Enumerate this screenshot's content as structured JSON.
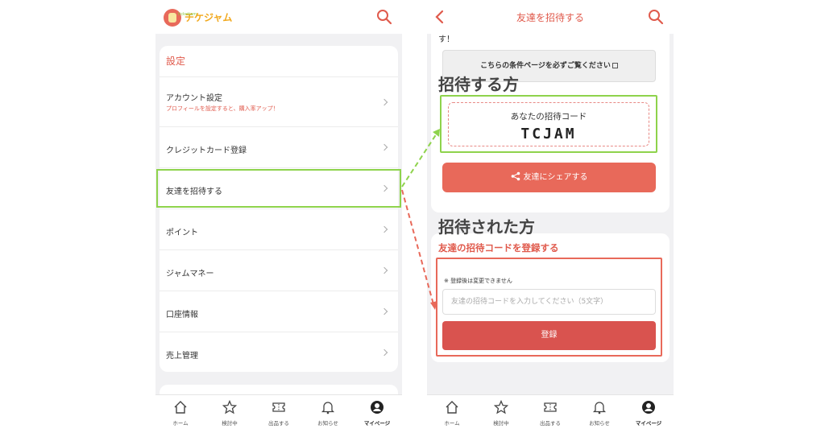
{
  "left": {
    "logo_text": "チケジャム",
    "logo_sub": "ticketjam",
    "settings_title": "設定",
    "rows": [
      {
        "label": "アカウント設定",
        "sub": "プロフィールを設定すると、購入率アップ！"
      },
      {
        "label": "クレジットカード登録"
      },
      {
        "label": "友達を招待する"
      },
      {
        "label": "ポイント"
      },
      {
        "label": "ジャムマネー"
      },
      {
        "label": "口座情報"
      },
      {
        "label": "売上管理"
      }
    ]
  },
  "right": {
    "header_title": "友達を招待する",
    "text_fragment": "す！",
    "condition_button": "こちらの条件ページを必ずご覧ください",
    "inviter_heading": "招待する方",
    "code_label": "あなたの招待コード",
    "code_value": "TCJAM",
    "share_button": "友達にシェアする",
    "invitee_heading": "招待された方",
    "register_title": "友達の招待コードを登録する",
    "register_note": "※ 登録後は変更できません",
    "register_placeholder": "友達の招待コードを入力してください（5文字）",
    "register_button": "登録"
  },
  "nav": {
    "items": [
      {
        "label": "ホーム",
        "icon": "home-icon"
      },
      {
        "label": "検討中",
        "icon": "star-icon"
      },
      {
        "label": "出品する",
        "icon": "ticket-icon"
      },
      {
        "label": "お知らせ",
        "icon": "bell-icon"
      },
      {
        "label": "マイページ",
        "icon": "user-icon"
      }
    ],
    "active": "マイページ"
  },
  "colors": {
    "accent": "#e05a4c",
    "highlight_green": "#8ed34c",
    "highlight_red": "#e8695a"
  }
}
